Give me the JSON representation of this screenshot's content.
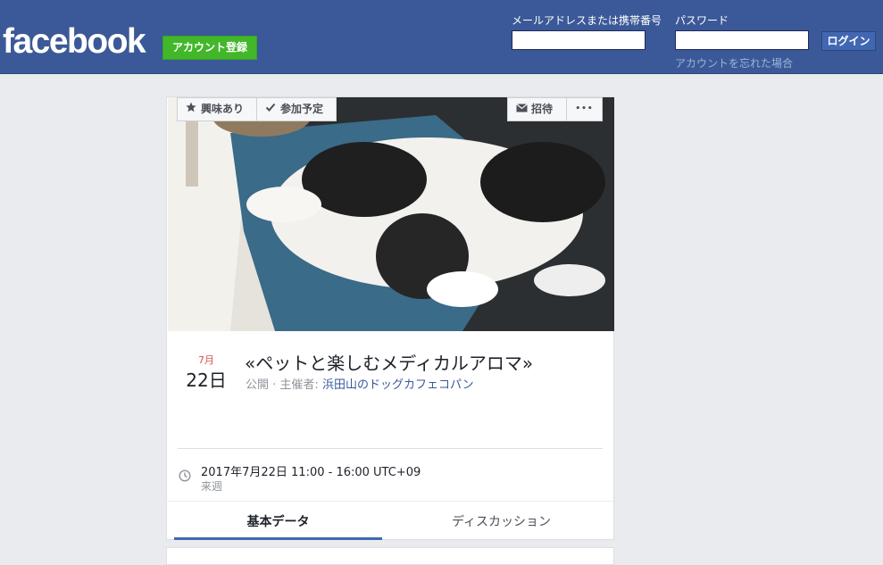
{
  "header": {
    "logo": "facebook",
    "signup_label": "アカウント登録",
    "email_label": "メールアドレスまたは携帯番号",
    "email_value": "",
    "password_label": "パスワード",
    "password_value": "",
    "login_label": "ログイン",
    "forgot_label": "アカウントを忘れた場合"
  },
  "event": {
    "month": "7月",
    "day": "22日",
    "title": "«ペットと楽しむメディカルアロマ»",
    "privacy": "公開",
    "host_prefix": "主催者: ",
    "host": "浜田山のドッグカフェコパン",
    "datetime": "2017年7月22日 11:00 - 16:00 UTC+09",
    "relative": "来週"
  },
  "actions": {
    "interested_label": "興味あり",
    "going_label": "参加予定",
    "invite_label": "招待",
    "more_label": "•••"
  },
  "tabs": [
    {
      "label": "基本データ",
      "active": true
    },
    {
      "label": "ディスカッション",
      "active": false
    }
  ],
  "colors": {
    "brand": "#3b5998",
    "signup_green": "#42b72a",
    "accent_blue": "#4267b2",
    "date_red": "#d9534f"
  }
}
